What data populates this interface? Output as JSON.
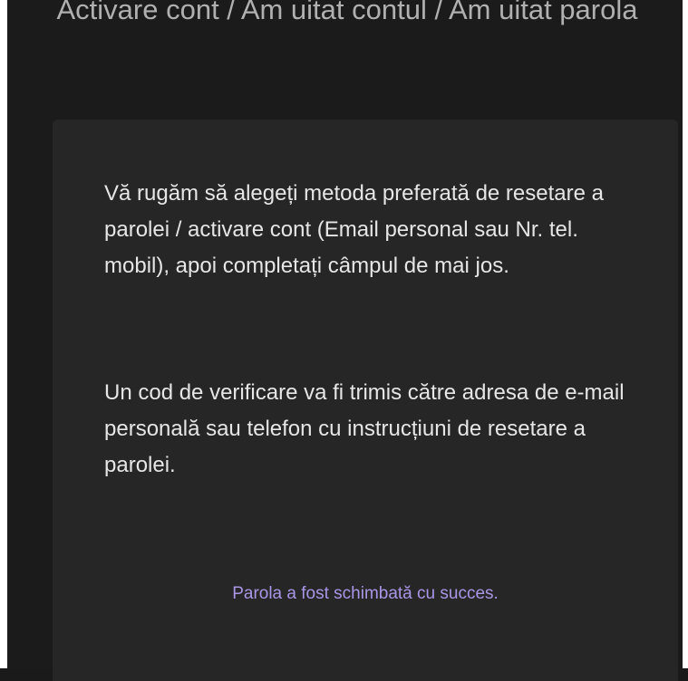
{
  "header": {
    "title": "Activare cont / Am uitat contul / Am uitat parola"
  },
  "card": {
    "instructions": [
      "Vă rugăm să alegeți metoda preferată de resetare a parolei / activare cont (Email personal sau Nr. tel. mobil), apoi completați câmpul de mai jos.",
      "Un cod de verificare va fi trimis către adresa de e-mail personală sau telefon cu instrucțiuni de resetare a parolei."
    ],
    "status_message": "Parola a fost schimbată cu succes."
  },
  "colors": {
    "background": "#1b1b1b",
    "card": "#262626",
    "text": "#e6e6e6",
    "title": "#b0b0b0",
    "success_accent": "#a996e6"
  }
}
